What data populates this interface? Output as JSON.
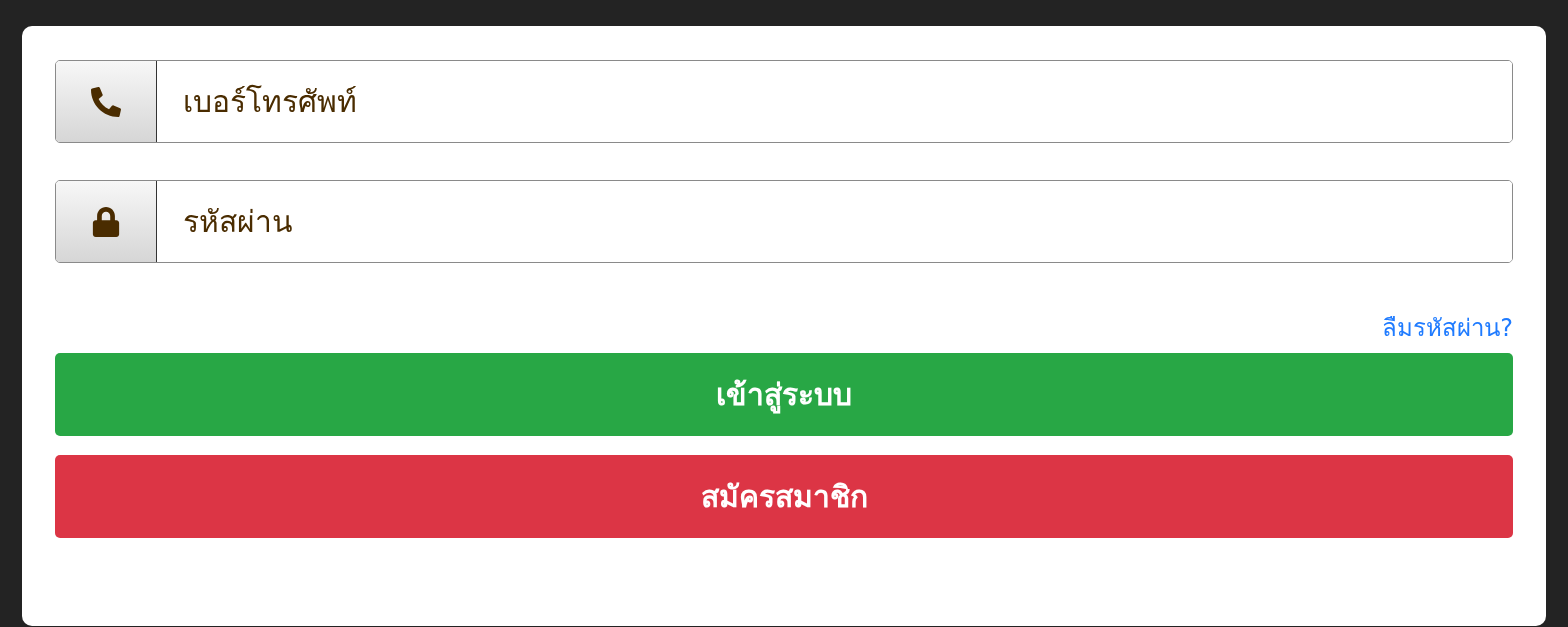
{
  "login_form": {
    "fields": [
      {
        "kind": "phone",
        "placeholder": "เบอร์โทรศัพท์"
      },
      {
        "kind": "password",
        "placeholder": "รหัสผ่าน"
      }
    ],
    "forgot_password_link": "ลืมรหัสผ่าน?",
    "buttons": [
      {
        "kind": "primary",
        "label": "เข้าสู่ระบบ"
      },
      {
        "kind": "danger",
        "label": "สมัครสมาชิก"
      }
    ]
  }
}
